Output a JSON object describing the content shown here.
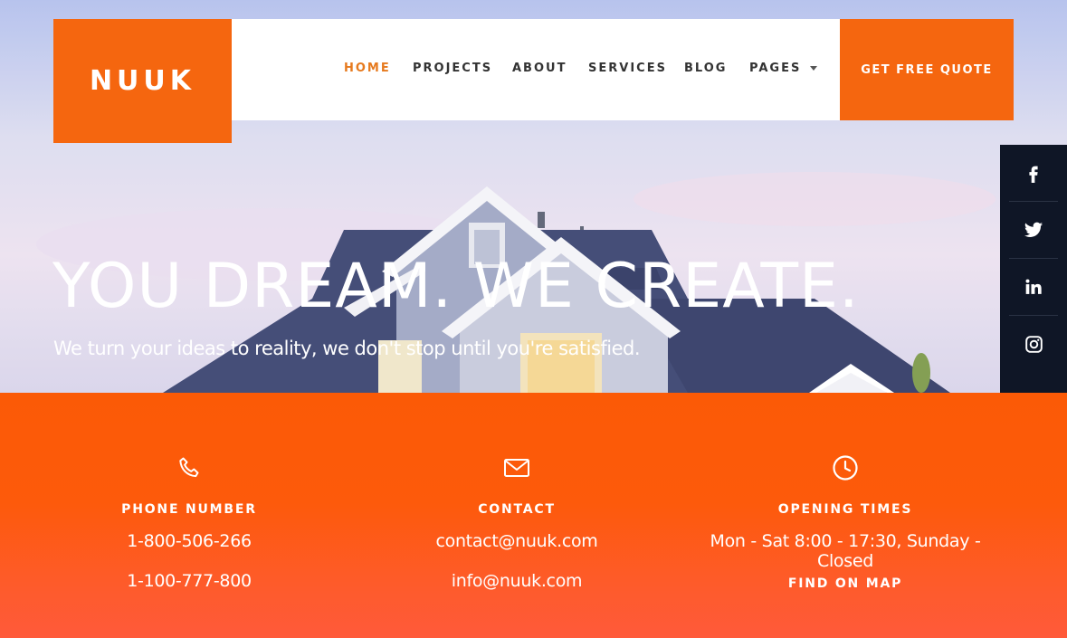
{
  "brand": {
    "logo_text": "NUUK"
  },
  "nav": {
    "items": [
      {
        "label": "HOME",
        "active": true
      },
      {
        "label": "PROJECTS"
      },
      {
        "label": "ABOUT"
      },
      {
        "label": "SERVICES"
      },
      {
        "label": "BLOG"
      },
      {
        "label": "PAGES",
        "has_dropdown": true
      }
    ],
    "cta_label": "GET FREE QUOTE"
  },
  "hero": {
    "title": "YOU DREAM. WE CREATE.",
    "subtitle": "We turn your ideas to reality, we don't stop until you're satisfied."
  },
  "social": [
    {
      "icon": "facebook-icon"
    },
    {
      "icon": "twitter-icon"
    },
    {
      "icon": "linkedin-icon"
    },
    {
      "icon": "instagram-icon"
    }
  ],
  "info": {
    "phone": {
      "icon": "phone-icon",
      "heading": "PHONE NUMBER",
      "lines": [
        "1-800-506-266",
        "1-100-777-800"
      ]
    },
    "contact": {
      "icon": "envelope-icon",
      "heading": "CONTACT",
      "lines": [
        "contact@nuuk.com",
        "info@nuuk.com"
      ]
    },
    "hours": {
      "icon": "clock-icon",
      "heading": "OPENING TIMES",
      "lines": [
        "Mon - Sat 8:00 - 17:30, Sunday - Closed"
      ],
      "map_link": "FIND ON MAP"
    }
  },
  "colors": {
    "accent": "#f5660f",
    "nav_active": "#e67a1e",
    "social_bar": "#0f1626",
    "info_gradient_top": "#fb5a06",
    "info_gradient_bottom": "#ff5a3a"
  }
}
